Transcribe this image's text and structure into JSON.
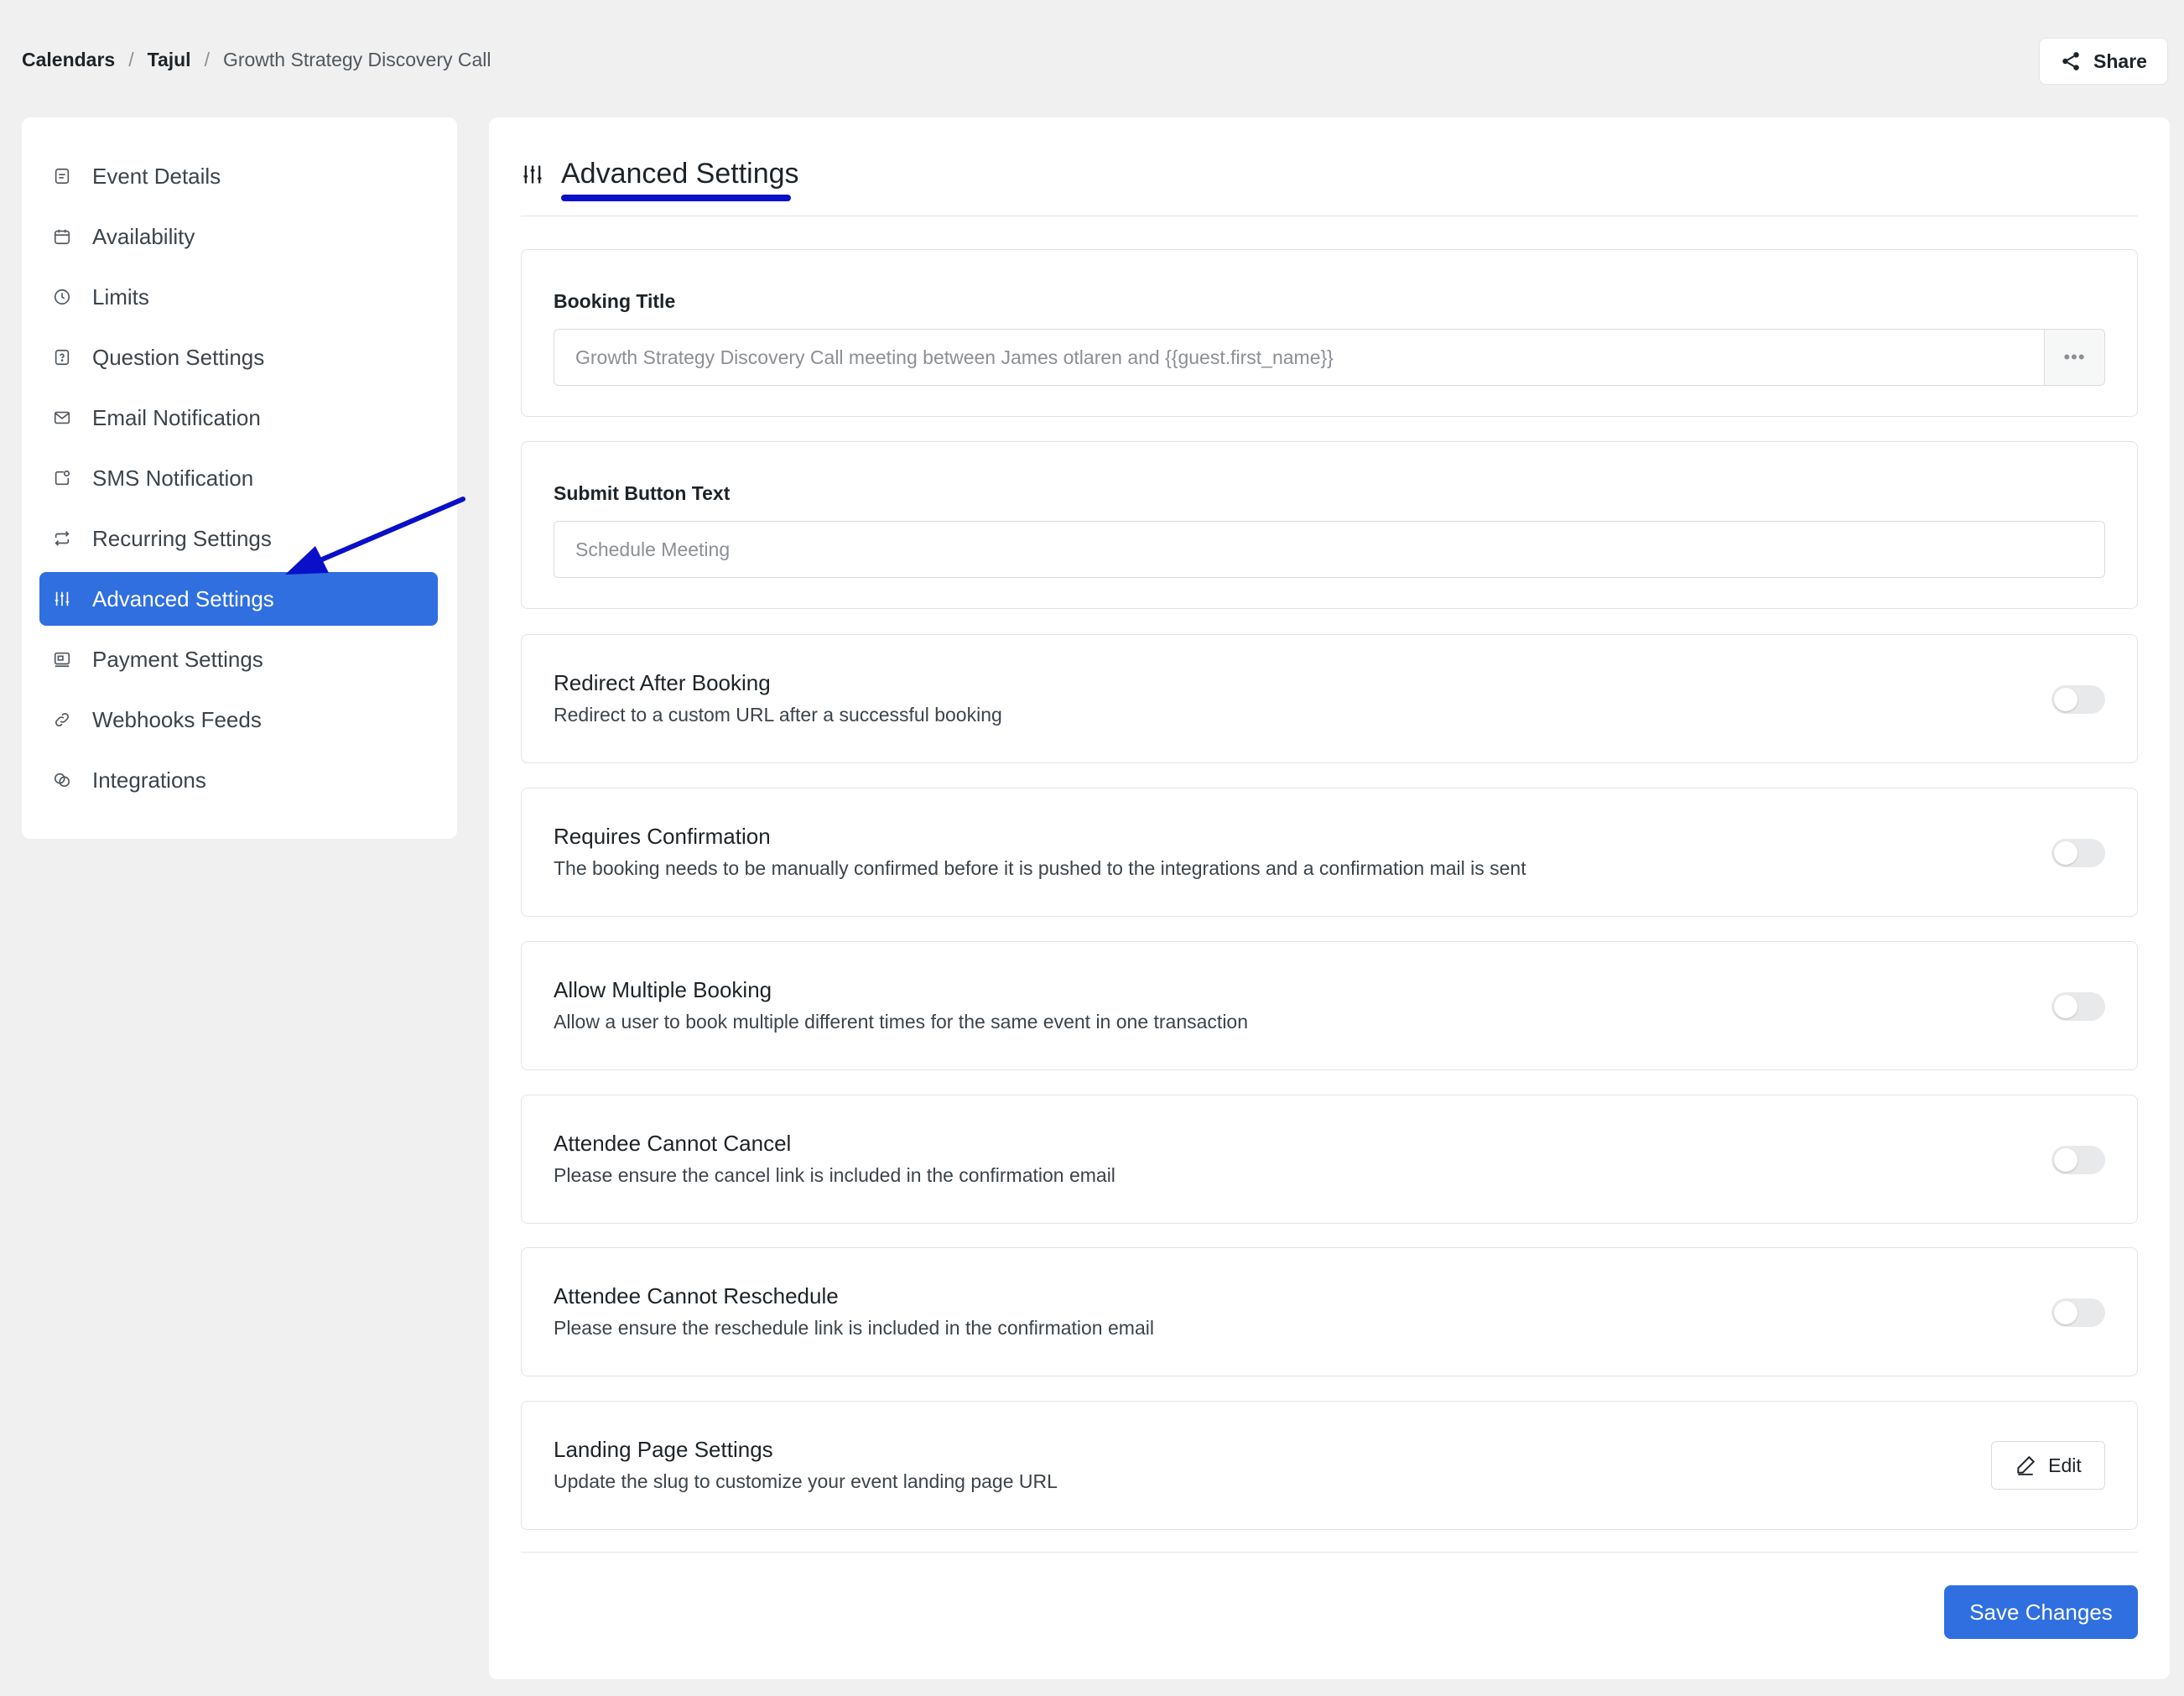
{
  "breadcrumb": {
    "calendars": "Calendars",
    "tajul": "Tajul",
    "current": "Growth Strategy Discovery Call",
    "separator": "/"
  },
  "share": {
    "label": "Share",
    "icon": "share-icon"
  },
  "sidebar": {
    "items": [
      {
        "label": "Event Details",
        "icon": "event-details-icon"
      },
      {
        "label": "Availability",
        "icon": "calendar-icon"
      },
      {
        "label": "Limits",
        "icon": "clock-icon"
      },
      {
        "label": "Question Settings",
        "icon": "question-icon"
      },
      {
        "label": "Email Notification",
        "icon": "mail-icon"
      },
      {
        "label": "SMS Notification",
        "icon": "sms-icon"
      },
      {
        "label": "Recurring Settings",
        "icon": "repeat-icon"
      },
      {
        "label": "Advanced Settings",
        "icon": "sliders-icon",
        "active": true
      },
      {
        "label": "Payment Settings",
        "icon": "payment-icon"
      },
      {
        "label": "Webhooks Feeds",
        "icon": "link-icon"
      },
      {
        "label": "Integrations",
        "icon": "integrations-icon"
      }
    ]
  },
  "main": {
    "title": "Advanced Settings",
    "booking_title": {
      "label": "Booking Title",
      "value": "Growth Strategy Discovery Call meeting between James otlaren and {{guest.first_name}}",
      "addon": "•••"
    },
    "submit_button_text": {
      "label": "Submit Button Text",
      "placeholder": "Schedule Meeting"
    },
    "settings": [
      {
        "title": "Redirect After Booking",
        "description": "Redirect to a custom URL after a successful booking",
        "enabled": false
      },
      {
        "title": "Requires Confirmation",
        "description": "The booking needs to be manually confirmed before it is pushed to the integrations and a confirmation mail is sent",
        "enabled": false
      },
      {
        "title": "Allow Multiple Booking",
        "description": "Allow a user to book multiple different times for the same event in one transaction",
        "enabled": false
      },
      {
        "title": "Attendee Cannot Cancel",
        "description": "Please ensure the cancel link is included in the confirmation email",
        "enabled": false
      },
      {
        "title": "Attendee Cannot Reschedule",
        "description": "Please ensure the reschedule link is included in the confirmation email",
        "enabled": false
      }
    ],
    "landing_page": {
      "title": "Landing Page Settings",
      "description": "Update the slug to customize your event landing page URL",
      "edit_label": "Edit"
    },
    "save_label": "Save Changes"
  },
  "colors": {
    "accent": "#2f6fe0",
    "annotation": "#0a10c8",
    "background": "#f0f0f1"
  }
}
